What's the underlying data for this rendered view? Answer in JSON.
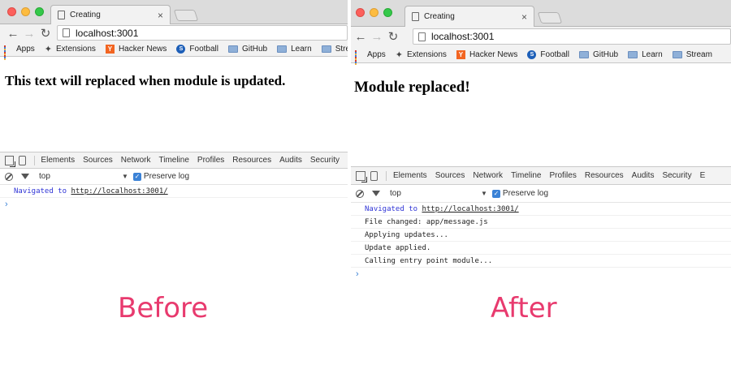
{
  "before": {
    "tab_title": "Creating",
    "tab_close": "×",
    "url": "localhost:3001",
    "bookmarks": [
      "Apps",
      "Extensions",
      "Hacker News",
      "Football",
      "GitHub",
      "Learn",
      "Strea"
    ],
    "heading": "This text will replaced when module is updated.",
    "devtools_tabs": [
      "Elements",
      "Sources",
      "Network",
      "Timeline",
      "Profiles",
      "Resources",
      "Audits",
      "Security"
    ],
    "context": "top",
    "preserve_log": "Preserve log",
    "console": {
      "nav_prefix": "Navigated to ",
      "nav_url": "http://localhost:3001/",
      "lines": []
    },
    "caption": "Before"
  },
  "after": {
    "tab_title": "Creating",
    "tab_close": "×",
    "url": "localhost:3001",
    "bookmarks": [
      "Apps",
      "Extensions",
      "Hacker News",
      "Football",
      "GitHub",
      "Learn",
      "Stream"
    ],
    "heading": "Module replaced!",
    "devtools_tabs": [
      "Elements",
      "Sources",
      "Network",
      "Timeline",
      "Profiles",
      "Resources",
      "Audits",
      "Security",
      "E"
    ],
    "context": "top",
    "preserve_log": "Preserve log",
    "console": {
      "nav_prefix": "Navigated to ",
      "nav_url": "http://localhost:3001/",
      "lines": [
        "File changed: app/message.js",
        "Applying updates...",
        "Update applied.",
        "Calling entry point module..."
      ]
    },
    "caption": "After"
  },
  "icons": {
    "back": "←",
    "forward": "→",
    "reload": "↻",
    "dropdown": "▼",
    "check": "✓",
    "prompt": "›",
    "extensions": "✦",
    "hacker_news": "Y",
    "football": "S"
  },
  "colors": {
    "caption": "#e83a6e",
    "console_nav": "#2f34d6",
    "accent": "#3b82d6"
  }
}
